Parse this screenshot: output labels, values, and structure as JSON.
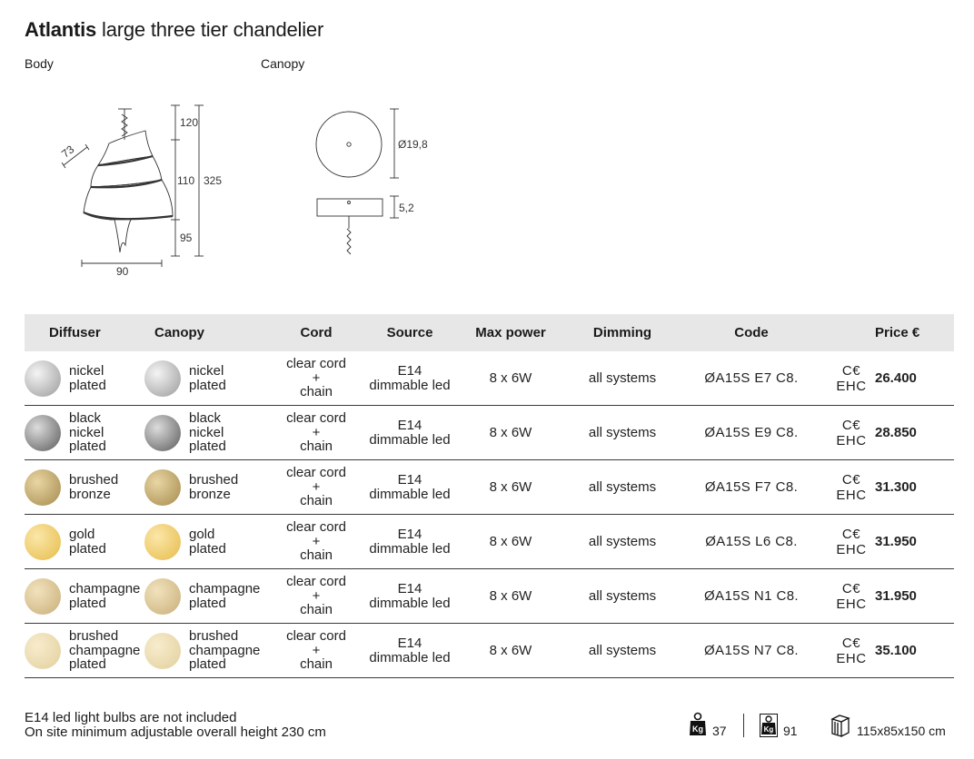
{
  "header": {
    "title_bold": "Atlantis",
    "title_rest": "large three tier chandelier"
  },
  "drawings": {
    "body_label": "Body",
    "canopy_label": "Canopy",
    "body_dims": {
      "top": "120",
      "middle": "110",
      "bottom": "95",
      "total": "325",
      "width": "90",
      "diagonal": "73"
    },
    "canopy_dims": {
      "diameter": "Ø19,8",
      "height": "5,2"
    }
  },
  "table": {
    "columns": [
      "Diffuser",
      "Canopy",
      "Cord",
      "Source",
      "Max power",
      "Dimming",
      "Code",
      "",
      "Price €"
    ],
    "rows": [
      {
        "diffuser": [
          "nickel",
          "plated"
        ],
        "canopy": [
          "nickel",
          "plated"
        ],
        "cord": [
          "clear cord",
          "+",
          "chain"
        ],
        "source": [
          "E14",
          "dimmable led"
        ],
        "max_power": "8 x 6W",
        "dimming": "all systems",
        "code": "ØA15S E7 C8.",
        "cert": "C€ EHC",
        "price": "26.400",
        "swatch": "nickel"
      },
      {
        "diffuser": [
          "black",
          "nickel",
          "plated"
        ],
        "canopy": [
          "black",
          "nickel",
          "plated"
        ],
        "cord": [
          "clear cord",
          "+",
          "chain"
        ],
        "source": [
          "E14",
          "dimmable led"
        ],
        "max_power": "8 x 6W",
        "dimming": "all systems",
        "code": "ØA15S E9 C8.",
        "cert": "C€ EHC",
        "price": "28.850",
        "swatch": "black_nickel"
      },
      {
        "diffuser": [
          "brushed",
          "bronze"
        ],
        "canopy": [
          "brushed",
          "bronze"
        ],
        "cord": [
          "clear cord",
          "+",
          "chain"
        ],
        "source": [
          "E14",
          "dimmable led"
        ],
        "max_power": "8 x 6W",
        "dimming": "all systems",
        "code": "ØA15S F7 C8.",
        "cert": "C€ EHC",
        "price": "31.300",
        "swatch": "bronze"
      },
      {
        "diffuser": [
          "gold",
          "plated"
        ],
        "canopy": [
          "gold",
          "plated"
        ],
        "cord": [
          "clear cord",
          "+",
          "chain"
        ],
        "source": [
          "E14",
          "dimmable led"
        ],
        "max_power": "8 x 6W",
        "dimming": "all systems",
        "code": "ØA15S L6 C8.",
        "cert": "C€ EHC",
        "price": "31.950",
        "swatch": "gold"
      },
      {
        "diffuser": [
          "champagne",
          "plated"
        ],
        "canopy": [
          "champagne",
          "plated"
        ],
        "cord": [
          "clear cord",
          "+",
          "chain"
        ],
        "source": [
          "E14",
          "dimmable led"
        ],
        "max_power": "8 x 6W",
        "dimming": "all systems",
        "code": "ØA15S N1 C8.",
        "cert": "C€ EHC",
        "price": "31.950",
        "swatch": "champagne"
      },
      {
        "diffuser": [
          "brushed",
          "champagne",
          "plated"
        ],
        "canopy": [
          "brushed",
          "champagne",
          "plated"
        ],
        "cord": [
          "clear cord",
          "+",
          "chain"
        ],
        "source": [
          "E14",
          "dimmable led"
        ],
        "max_power": "8 x 6W",
        "dimming": "all systems",
        "code": "ØA15S N7 C8.",
        "cert": "C€ EHC",
        "price": "35.100",
        "swatch": "brushed_champagne"
      }
    ]
  },
  "swatch_colors": {
    "nickel": [
      "#f4f4f4",
      "#9a9a9a"
    ],
    "black_nickel": [
      "#dcdcdc",
      "#5a5a5a"
    ],
    "bronze": [
      "#e9d6a4",
      "#a48a4c"
    ],
    "gold": [
      "#fbe7a9",
      "#e6bb4a"
    ],
    "champagne": [
      "#f1e2bd",
      "#c9ae78"
    ],
    "brushed_champagne": [
      "#f7eccd",
      "#e2cf9c"
    ]
  },
  "footer": {
    "note1": "E14 led light bulbs are not included",
    "note2": "On site minimum adjustable overall height 230 cm",
    "net_weight_icon": "weight-icon",
    "net_weight": "37",
    "gross_weight_icon": "package-weight-icon",
    "gross_weight": "91",
    "box_icon": "box-icon",
    "box_size": "115x85x150 cm"
  }
}
